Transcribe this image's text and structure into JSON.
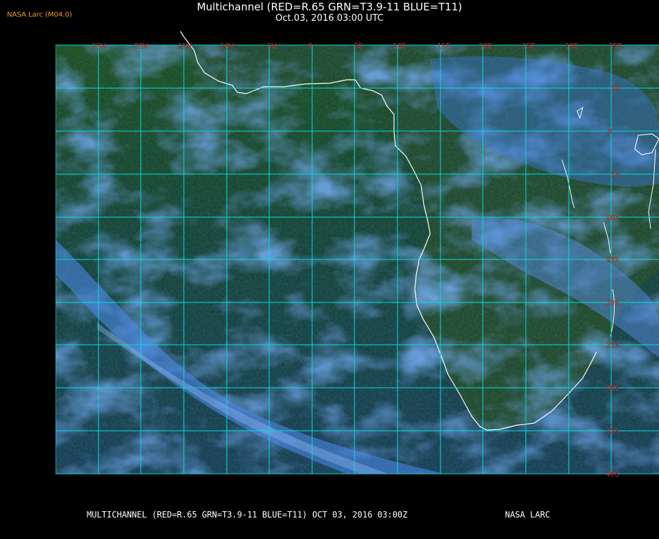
{
  "header": {
    "title": "Multichannel (RED=R.65 GRN=T3.9-11 BLUE=T11)",
    "timestamp": "Oct.03, 2016 03:00 UTC",
    "org_tag": "NASA Larc (M04.0)"
  },
  "map": {
    "longitude_labels": [
      "25W",
      "20W",
      "15W",
      "10W",
      "5W",
      "0",
      "5E",
      "10E",
      "15E",
      "20E",
      "25E",
      "30E",
      "35E"
    ],
    "latitude_labels": [
      "5N",
      "0",
      "5S",
      "10S",
      "15S",
      "20S",
      "25S",
      "30S",
      "35S",
      "40S"
    ],
    "colors": {
      "grid": "#00e0e0",
      "label": "#c0282a",
      "coast": "#ffffff",
      "ocean": "#1a4848",
      "land": "#1f4a2a",
      "cloud": "#3a78e8"
    }
  },
  "footer": {
    "caption": "MULTICHANNEL (RED=R.65 GRN=T3.9-11 BLUE=T11) OCT 03, 2016 03:00Z",
    "credit": "NASA LARC"
  }
}
